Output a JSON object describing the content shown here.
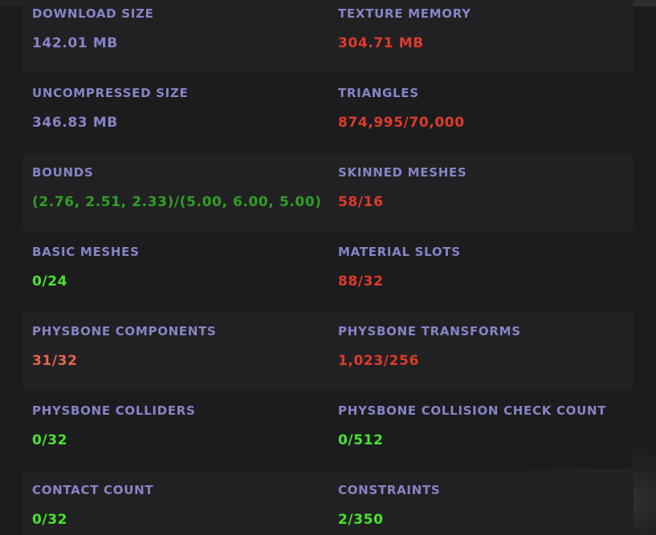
{
  "stats": [
    {
      "left": {
        "label": "DOWNLOAD SIZE",
        "value": "142.01 MB",
        "status": "neutral"
      },
      "right": {
        "label": "TEXTURE MEMORY",
        "value": "304.71 MB",
        "status": "bad"
      }
    },
    {
      "left": {
        "label": "UNCOMPRESSED SIZE",
        "value": "346.83 MB",
        "status": "neutral"
      },
      "right": {
        "label": "TRIANGLES",
        "value": "874,995/70,000",
        "status": "bad"
      }
    },
    {
      "left": {
        "label": "BOUNDS",
        "value": "(2.76, 2.51, 2.33)/(5.00, 6.00, 5.00)",
        "status": "ok"
      },
      "right": {
        "label": "SKINNED MESHES",
        "value": "58/16",
        "status": "bad"
      }
    },
    {
      "left": {
        "label": "BASIC MESHES",
        "value": "0/24",
        "status": "good"
      },
      "right": {
        "label": "MATERIAL SLOTS",
        "value": "88/32",
        "status": "bad"
      }
    },
    {
      "left": {
        "label": "PHYSBONE COMPONENTS",
        "value": "31/32",
        "status": "warn"
      },
      "right": {
        "label": "PHYSBONE TRANSFORMS",
        "value": "1,023/256",
        "status": "bad"
      }
    },
    {
      "left": {
        "label": "PHYSBONE COLLIDERS",
        "value": "0/32",
        "status": "good"
      },
      "right": {
        "label": "PHYSBONE COLLISION CHECK COUNT",
        "value": "0/512",
        "status": "good"
      }
    },
    {
      "left": {
        "label": "CONTACT COUNT",
        "value": "0/32",
        "status": "good"
      },
      "right": {
        "label": "CONSTRAINTS",
        "value": "2/350",
        "status": "good"
      }
    }
  ],
  "colors": {
    "neutral": "#8784c6",
    "bad": "#e03a2b",
    "warn": "#e8654c",
    "good": "#47e62c",
    "ok": "#2fa024",
    "label": "#8784c6",
    "row_alt_bg": "#212123",
    "page_bg": "#1c1c1e"
  }
}
